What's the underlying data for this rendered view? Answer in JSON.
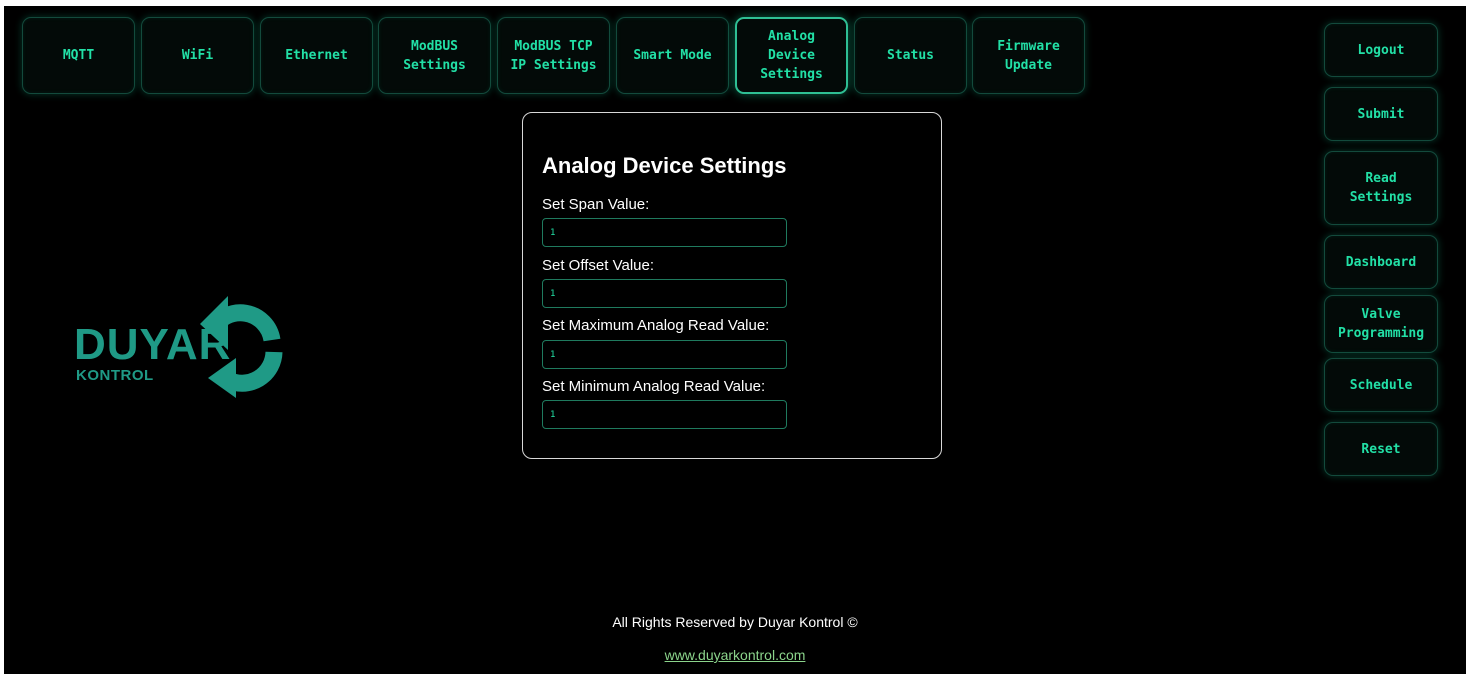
{
  "nav": {
    "tabs": [
      {
        "label": "MQTT"
      },
      {
        "label": "WiFi"
      },
      {
        "label": "Ethernet"
      },
      {
        "label": "ModBUS\nSettings"
      },
      {
        "label": "ModBUS TCP\nIP Settings"
      },
      {
        "label": "Smart Mode"
      },
      {
        "label": "Analog\nDevice\nSettings",
        "active": true
      },
      {
        "label": "Status"
      },
      {
        "label": "Firmware\nUpdate"
      }
    ]
  },
  "sidebar": {
    "buttons": [
      {
        "label": "Logout"
      },
      {
        "label": "Submit"
      },
      {
        "label": "Read\nSettings"
      },
      {
        "label": "Dashboard"
      },
      {
        "label": "Valve\nProgramming"
      },
      {
        "label": "Schedule"
      },
      {
        "label": "Reset"
      }
    ]
  },
  "form": {
    "title": "Analog Device Settings",
    "fields": [
      {
        "label": "Set Span Value:",
        "value": "1"
      },
      {
        "label": "Set Offset Value:",
        "value": "1"
      },
      {
        "label": "Set Maximum Analog Read Value:",
        "value": "1"
      },
      {
        "label": "Set Minimum Analog Read Value:",
        "value": "1"
      }
    ]
  },
  "logo": {
    "word": "DUYAR",
    "sub": "KONTROL",
    "icon": "circular-arrows-icon"
  },
  "footer": {
    "copyright": "All Rights Reserved by Duyar Kontrol ©",
    "link": "www.duyarkontrol.com"
  },
  "colors": {
    "background": "#000000",
    "accent": "#22e0a6",
    "brand": "#1f9a86",
    "link": "#8bd48b"
  }
}
